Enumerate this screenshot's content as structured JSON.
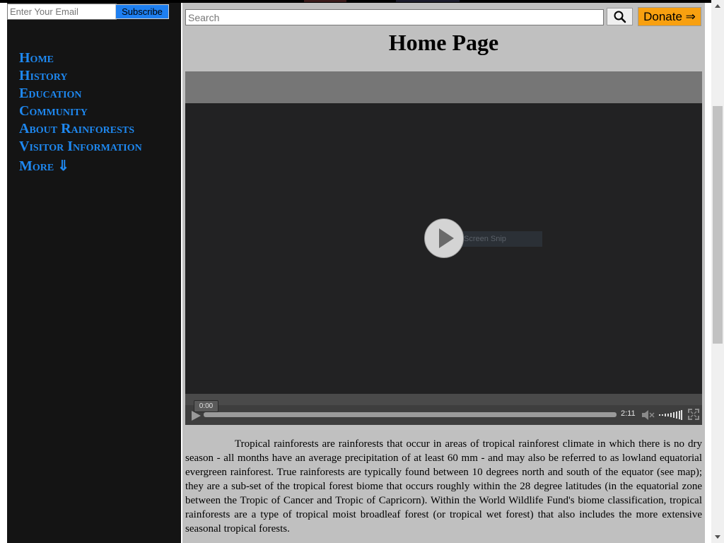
{
  "sidebar": {
    "email_placeholder": "Enter Your Email",
    "subscribe_label": "Subscribe",
    "nav": {
      "home": "Home",
      "history": "History",
      "education": "Education",
      "community": "Community",
      "about": "About Rainforests",
      "visitor": "Visitor Information",
      "more": "More ⇓"
    }
  },
  "header": {
    "search_placeholder": "Search",
    "donate_label": "Donate ⇒",
    "page_title": "Home Page"
  },
  "video": {
    "current_time": "0:00",
    "duration": "2:11",
    "overlay_label": "Screen Snip",
    "progress": 0
  },
  "article": {
    "text": "Tropical rainforests are rainforests that occur in areas of tropical rainforest climate in which there is no dry season - all months have an average precipitation of at least 60 mm - and may also be referred to as lowland equatorial evergreen rainforest. True rainforests are typically found between 10 degrees north and south of the equator (see map); they are a sub-set of the tropical forest biome that occurs roughly within the 28 degree latitudes (in the equatorial zone between the Tropic of Cancer and Tropic of Capricorn). Within the World Wildlife Fund's biome classification, tropical rainforests are a type of tropical moist broadleaf forest (or tropical wet forest) that also includes the more extensive seasonal tropical forests."
  },
  "colors": {
    "sidebar_bg": "#141414",
    "nav_link": "#1e88f0",
    "subscribe_button": "#1e7ff0",
    "donate_button": "#f8a010",
    "main_bg": "#c0c0c0"
  },
  "icons": {
    "search": "magnifier-icon",
    "play": "play-icon",
    "mute": "speaker-icon",
    "volume": "volume-bars-icon",
    "fullscreen": "fullscreen-icon"
  }
}
